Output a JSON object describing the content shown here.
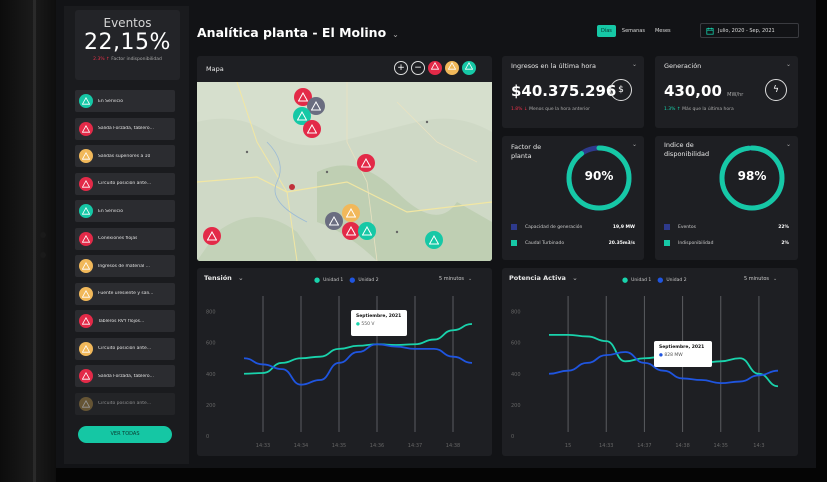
{
  "sidebar": {
    "kpi": {
      "title": "Eventos",
      "value": "22,15%",
      "delta": "2.3%",
      "delta_label": "Factor indisponibilidad"
    },
    "alerts": [
      {
        "label": "En Servicio",
        "type": "ok",
        "color": "#16c8a6"
      },
      {
        "label": "Salida Forzada, tablero...",
        "type": "error",
        "color": "#e32a48"
      },
      {
        "label": "Salidas superiores a 10",
        "type": "warn",
        "color": "#f1b85a"
      },
      {
        "label": "Circuito posición ante...",
        "type": "error",
        "color": "#e32a48"
      },
      {
        "label": "En Servicio",
        "type": "ok",
        "color": "#16c8a6"
      },
      {
        "label": "Conexiones flojas",
        "type": "error",
        "color": "#e32a48"
      },
      {
        "label": "Ingresos de material ...",
        "type": "warn",
        "color": "#f1b85a"
      },
      {
        "label": "Fuente uresiente y sali...",
        "type": "warn",
        "color": "#f1b85a"
      },
      {
        "label": "Tableros RVY flojos...",
        "type": "error",
        "color": "#e32a48"
      },
      {
        "label": "Circuito posición ante...",
        "type": "warn",
        "color": "#f1b85a"
      },
      {
        "label": "Salida Forzada, tablero...",
        "type": "error",
        "color": "#e32a48"
      },
      {
        "label": "Circuito posición ante...",
        "type": "warn",
        "color": "#a38446"
      }
    ],
    "view_all": "VER TODAS"
  },
  "header": {
    "title": "Analítica planta - El Molino",
    "tabs": [
      "Días",
      "Semanas",
      "Meses"
    ],
    "active_tab": "Días",
    "date_range": "Julio, 2020 - Sep, 2021"
  },
  "map": {
    "title": "Mapa"
  },
  "ingresos": {
    "title": "Ingresos en la última hora",
    "value": "$40.375.296",
    "delta": "1.8%",
    "delta_label": "Menos que la hora anterior"
  },
  "generacion": {
    "title": "Generación",
    "value": "430,00",
    "unit": "MW/hr",
    "delta": "1.3%",
    "delta_label": "Más que la última hora"
  },
  "factor": {
    "title": "Factor de planta",
    "value": "90%",
    "percent": 90,
    "rows": [
      {
        "label": "Capacidad de generación",
        "value": "19,9 MW"
      },
      {
        "label": "Caudal Turbinado",
        "value": "20.35m3/s"
      }
    ]
  },
  "indice": {
    "title": "Indice de disponibilidad",
    "value": "98%",
    "percent": 98,
    "rows": [
      {
        "label": "Eventos",
        "value": "22%"
      },
      {
        "label": "Indisponibilidad",
        "value": "2%"
      }
    ]
  },
  "tension": {
    "title": "Tensión",
    "legend": [
      "Unidad 1",
      "Unidad 2"
    ],
    "interval": "5 minutos",
    "tooltip": {
      "title": "Septiembre, 2021",
      "value": "550",
      "unit": "V"
    }
  },
  "potencia": {
    "title": "Potencia Activa",
    "legend": [
      "Unidad 1",
      "Unidad 2"
    ],
    "interval": "5 minutos",
    "tooltip": {
      "title": "Septiembre, 2021",
      "value": "828",
      "unit": "MW"
    }
  },
  "chart_data": [
    {
      "type": "line",
      "title": "Tensión",
      "categories": [
        "14:33",
        "14:34",
        "14:35",
        "14:36",
        "14:37",
        "14:38"
      ],
      "y_ticks": [
        "0",
        "200",
        "400",
        "600",
        "800"
      ],
      "ylim": [
        0,
        900
      ],
      "series": [
        {
          "name": "Unidad 1",
          "color": "#19d3ac",
          "x": [
            0,
            0.5,
            1,
            1.5,
            2,
            2.5,
            3,
            3.5,
            4,
            4.5,
            5,
            5.5,
            6
          ],
          "values": [
            400,
            405,
            470,
            500,
            510,
            560,
            580,
            590,
            585,
            590,
            620,
            680,
            720
          ]
        },
        {
          "name": "Unidad 2",
          "color": "#1f55e0",
          "x": [
            0,
            0.5,
            1,
            1.5,
            2,
            2.5,
            3,
            3.5,
            4,
            4.5,
            5,
            5.5,
            6
          ],
          "values": [
            500,
            460,
            430,
            330,
            360,
            470,
            540,
            590,
            575,
            560,
            560,
            510,
            470
          ]
        }
      ]
    },
    {
      "type": "line",
      "title": "Potencia Activa",
      "categories": [
        "15",
        "14:33",
        "14:37",
        "14:38",
        "14:35",
        "14:3"
      ],
      "y_ticks": [
        "0",
        "200",
        "400",
        "600",
        "800"
      ],
      "ylim": [
        0,
        900
      ],
      "series": [
        {
          "name": "Unidad 1",
          "color": "#19d3ac",
          "x": [
            0,
            0.5,
            1,
            1.5,
            2,
            2.5,
            3,
            3.5,
            4,
            4.5,
            5,
            5.5,
            6
          ],
          "values": [
            650,
            650,
            640,
            610,
            480,
            500,
            510,
            500,
            470,
            480,
            500,
            400,
            320
          ]
        },
        {
          "name": "Unidad 2",
          "color": "#1f55e0",
          "x": [
            0,
            0.5,
            1,
            1.5,
            2,
            2.5,
            3,
            3.5,
            4,
            4.5,
            5,
            5.5,
            6
          ],
          "values": [
            400,
            420,
            470,
            520,
            540,
            470,
            420,
            370,
            360,
            340,
            350,
            390,
            420
          ]
        }
      ]
    }
  ]
}
